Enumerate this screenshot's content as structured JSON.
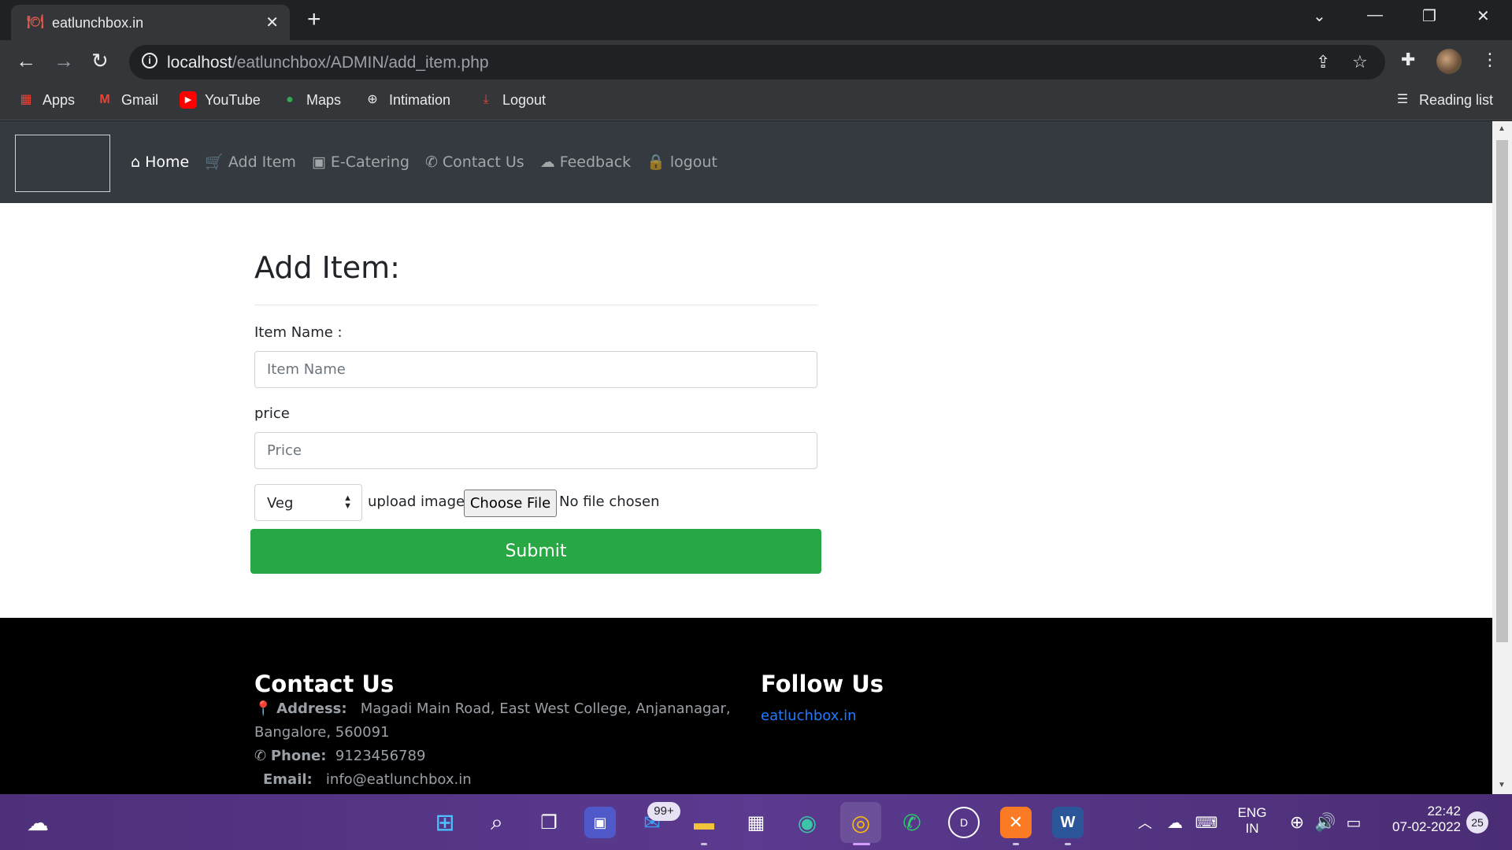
{
  "browser": {
    "tab_title": "eatlunchbox.in",
    "url_host": "localhost",
    "url_path": "/eatlunchbox/ADMIN/add_item.php",
    "bookmarks": [
      {
        "label": "Apps",
        "icon": "apps-grid-icon"
      },
      {
        "label": "Gmail",
        "icon": "gmail-icon"
      },
      {
        "label": "YouTube",
        "icon": "youtube-icon"
      },
      {
        "label": "Maps",
        "icon": "maps-pin-icon"
      },
      {
        "label": "Intimation",
        "icon": "globe-icon"
      },
      {
        "label": "Logout",
        "icon": "logout-arrow-icon"
      }
    ],
    "reading_list": "Reading list"
  },
  "site_nav": {
    "items": [
      {
        "label": "Home",
        "icon": "home-icon"
      },
      {
        "label": "Add Item",
        "icon": "cart-icon"
      },
      {
        "label": "E-Catering",
        "icon": "cubes-icon"
      },
      {
        "label": "Contact Us",
        "icon": "phone-icon"
      },
      {
        "label": "Feedback",
        "icon": "cloud-icon"
      },
      {
        "label": "logout",
        "icon": "lock-icon"
      }
    ]
  },
  "form": {
    "title": "Add Item:",
    "item_name_label": "Item Name :",
    "item_name_placeholder": "Item Name",
    "price_label": "price",
    "price_placeholder": "Price",
    "type_select_value": "Veg",
    "upload_label": "upload image",
    "choose_file": "Choose File",
    "no_file": "No file chosen",
    "submit": "Submit"
  },
  "footer": {
    "contact_heading": "Contact Us",
    "follow_heading": "Follow Us",
    "address_label": "Address:",
    "address_line1": "Magadi Main Road, East West College, Anjananagar,",
    "address_line2": "Bangalore, 560091",
    "phone_label": "Phone:",
    "phone": "9123456789",
    "email_label": "Email:",
    "email": "info@eatlunchbox.in",
    "follow_link": "eatluchbox.in"
  },
  "taskbar": {
    "mail_badge": "99+",
    "lang_line1": "ENG",
    "lang_line2": "IN",
    "time": "22:42",
    "date": "07-02-2022",
    "notif_count": "25"
  },
  "colors": {
    "nav_bg": "#343a40",
    "submit_bg": "#28a745",
    "footer_bg": "#000000",
    "link": "#1e7bff"
  }
}
